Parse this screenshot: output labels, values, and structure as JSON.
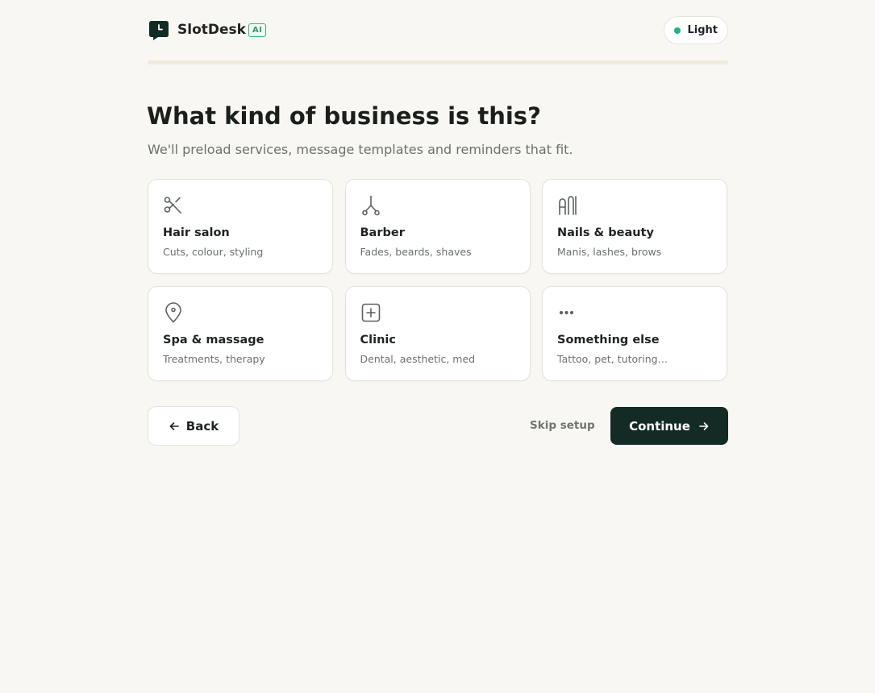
{
  "brand": {
    "name": "SlotDesk",
    "badge": "AI",
    "logo_icon": "chat-bubble-clock-icon"
  },
  "theme_toggle": {
    "label": "Light",
    "status_color": "#22b07d"
  },
  "onboarding": {
    "progress": 0
  },
  "page": {
    "title": "What kind of business is this?",
    "subtitle": "We'll preload services, message templates and reminders that fit."
  },
  "business_types": [
    {
      "title": "Hair salon",
      "description": "Cuts, colour, styling",
      "icon": "scissors-icon"
    },
    {
      "title": "Barber",
      "description": "Fades, beards, shaves",
      "icon": "barber-scissors-icon"
    },
    {
      "title": "Nails & beauty",
      "description": "Manis, lashes, brows",
      "icon": "nails-icon"
    },
    {
      "title": "Spa & massage",
      "description": "Treatments, therapy",
      "icon": "location-pin-icon"
    },
    {
      "title": "Clinic",
      "description": "Dental, aesthetic, med",
      "icon": "plus-square-icon"
    },
    {
      "title": "Something else",
      "description": "Tattoo, pet, tutoring…",
      "icon": "more-dots-icon"
    }
  ],
  "actions": {
    "back_label": "Back",
    "skip_label": "Skip setup",
    "continue_label": "Continue"
  },
  "colors": {
    "primary": "#142a25",
    "accent": "#22b07d",
    "background": "#f9f7f3"
  }
}
